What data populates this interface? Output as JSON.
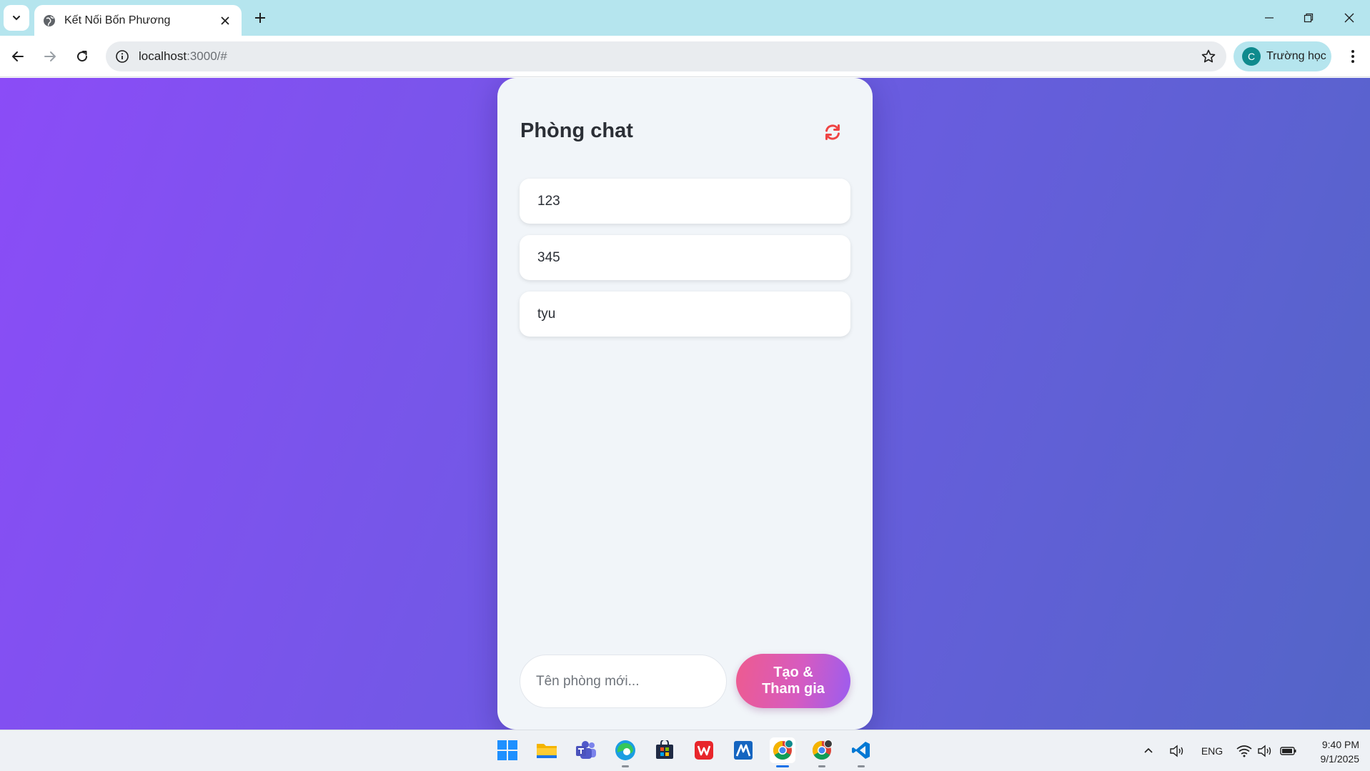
{
  "browser": {
    "tab": {
      "title": "Kết Nối Bốn Phương"
    },
    "url": {
      "host": "localhost",
      "rest": ":3000/#"
    },
    "profile": {
      "initial": "C",
      "name": "Trường học"
    }
  },
  "page": {
    "title": "Phòng chat",
    "rooms": [
      {
        "name": "123"
      },
      {
        "name": "345"
      },
      {
        "name": "tyu"
      }
    ],
    "new_room": {
      "placeholder": "Tên phòng mới...",
      "value": ""
    },
    "create_button": {
      "line1": "Tạo &",
      "line2": "Tham gia"
    },
    "colors": {
      "gradient_start": "#8b4cf7",
      "gradient_end": "#5365c7",
      "refresh_icon": "#ef4444",
      "panel": "#f1f5f9"
    }
  },
  "taskbar": {
    "apps": [
      "windows-start",
      "file-explorer",
      "teams",
      "edge",
      "microsoft-store",
      "wps-office",
      "app-m",
      "chrome-profile-c",
      "chrome",
      "vscode"
    ],
    "tray": {
      "language": "ENG"
    },
    "clock": {
      "time": "9:40 PM",
      "date": "9/1/2025"
    }
  }
}
